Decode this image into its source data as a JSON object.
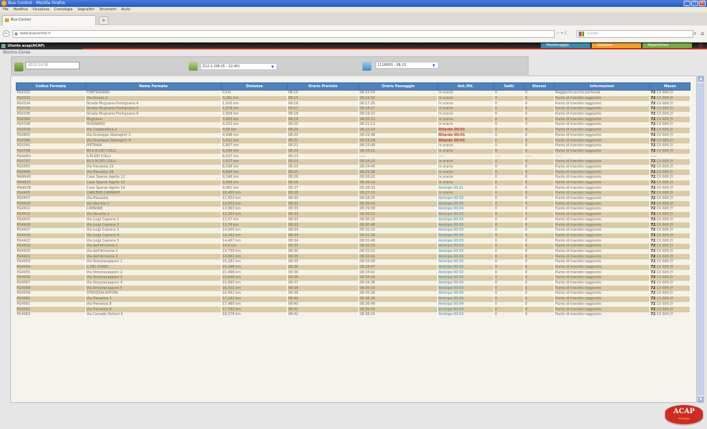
{
  "window": {
    "title": "Bus Control - Mozilla Firefox",
    "minimize": "_",
    "maximize": "□",
    "close": "×"
  },
  "menu": [
    "File",
    "Modifica",
    "Visualizza",
    "Cronologia",
    "Segnalibri",
    "Strumenti",
    "Aiuto"
  ],
  "browser": {
    "tab_title": "Bus Control",
    "new_tab": "+",
    "back": "←",
    "url": "www.buscontrol.it",
    "url_controls": "☆ ▾ C",
    "search_placeholder": "Google",
    "nav_icons": [
      "⌕",
      "⌂"
    ]
  },
  "app": {
    "user": "Utente acap(ACAP)",
    "tabs": [
      "Monitoraggio",
      "Gestione",
      "Reportistica"
    ],
    "power": "⏻",
    "section_title": "Storico Corse",
    "filters": {
      "date": "2012-10-30",
      "route": "Z12-1 (08:15 - 12:40)",
      "trip": "1116650 - 08:15",
      "dropdown_arrow": "▼"
    },
    "columns": [
      "Codice Fermata",
      "Nome Fermata",
      "Distanza",
      "Orario Previsto",
      "Orario Passaggio",
      "Ant./Rit.",
      "Saliti",
      "Discesi",
      "Informazioni",
      "Mezzo"
    ],
    "rows": [
      [
        "PG0332",
        "FONTIGNANO",
        "0 km",
        "08:15",
        "08:15:54",
        "In orario",
        "0",
        "0",
        "Raggiunto punto partenza",
        "72",
        "CX 600 JY"
      ],
      [
        "PG0333",
        "Via Arezzo 2",
        "0,361 km",
        "08:15",
        "08:16:50",
        "In orario",
        "0",
        "0",
        "Punto di transito raggiunto",
        "72",
        "CX 600 JY"
      ],
      [
        "PG0334",
        "Strada Mugnano-Fontignano 4",
        "1,016 km",
        "08:16",
        "08:17:35",
        "In orario",
        "0",
        "0",
        "Punto di transito raggiunto",
        "72",
        "CX 600 JY"
      ],
      [
        "PG0335",
        "Strada Mugnano-Fontignano 5",
        "1,878 km",
        "08:17",
        "08:18:27",
        "In orario",
        "0",
        "0",
        "Punto di transito raggiunto",
        "72",
        "CX 600 JY"
      ],
      [
        "PG0336",
        "Strada Mugnano-Fontignano 6",
        "2,958 km",
        "08:18",
        "08:19:32",
        "In orario",
        "0",
        "0",
        "Punto di transito raggiunto",
        "72",
        "CX 600 JY"
      ],
      [
        "PG0360",
        "Mugnano",
        "3,683 km",
        "08:19",
        "08:20:12",
        "In orario",
        "0",
        "0",
        "Punto di transito raggiunto",
        "72",
        "CX 600 JY"
      ],
      [
        "PG0338",
        "MUGNANO",
        "4,253 km",
        "08:20",
        "08:21:13",
        "In orario",
        "0",
        "0",
        "Punto di transito raggiunto",
        "72",
        "CX 600 JY"
      ],
      [
        "PG0339",
        "Via Cooperativa 2",
        "4,58 km",
        "08:20",
        "08:22:14",
        "Ritardo 00:01",
        "0",
        "0",
        "Punto di transito raggiunto",
        "72",
        "CX 600 JY"
      ],
      [
        "PG0855",
        "Via Giuseppe Sbaraglini 3",
        "4,948 km",
        "08:20",
        "08:22:48",
        "Ritardo 00:01",
        "0",
        "0",
        "Punto di transito raggiunto",
        "72",
        "CX 600 JY"
      ],
      [
        "PG0340",
        "Via Giuseppe Sbaraglini 4",
        "5,452 km",
        "08:21",
        "08:23:18",
        "Ritardo 00:01",
        "0",
        "0",
        "Punto di transito raggiunto",
        "72",
        "CX 600 JY"
      ],
      [
        "PG0341",
        "PIETRAIA",
        "5,807 km",
        "08:22",
        "08:23:49",
        "In orario",
        "0",
        "0",
        "Punto di transito raggiunto",
        "72",
        "CX 600 JY"
      ],
      [
        "PG0708",
        "BV.S.M.DEI COLLI",
        "6,206 km",
        "08:23",
        "08:24:11",
        "In orario",
        "0",
        "0",
        "Punto di transito raggiunto",
        "72",
        "CX 600 JY"
      ],
      [
        "PGAAEU",
        "S.M.DEI COLLI",
        "6,937 km",
        "08:23",
        "-----",
        "-----",
        "-----",
        "-----",
        "-----",
        "",
        "-----"
      ],
      [
        "PG0707",
        "BV.S.M.DEI COLLI",
        "7,627 km",
        "08:23",
        "08:24:15",
        "In orario",
        "0",
        "0",
        "Punto di transito raggiunto",
        "72",
        "CX 600 JY"
      ],
      [
        "PG0455",
        "Via Pievaiola 25",
        "8,036 km",
        "08:23",
        "08:24:45",
        "In orario",
        "0",
        "0",
        "Punto di transito raggiunto",
        "72",
        "CX 600 JY"
      ],
      [
        "PG0456",
        "Via Pievaiola 26",
        "8,884 km",
        "08:25",
        "08:25:38",
        "In orario",
        "0",
        "0",
        "Punto di transito raggiunto",
        "72",
        "CX 600 JY"
      ],
      [
        "MA9640",
        "Case Sparse Agello 12",
        "9,348 km",
        "08:26",
        "08:26:02",
        "In orario",
        "0",
        "0",
        "Punto di transito raggiunto",
        "72",
        "CX 600 JY"
      ],
      [
        "MA9637",
        "Case Sparse Agello 13",
        "9,584 km",
        "08:26",
        "08:26:14",
        "In orario",
        "0",
        "0",
        "Punto di transito raggiunto",
        "72",
        "CX 600 JY"
      ],
      [
        "MA9638",
        "Case Sparse Agello 14",
        "9,961 km",
        "08:27",
        "08:26:33",
        "Anticipo 00:01",
        "0",
        "0",
        "Punto di transito raggiunto",
        "72",
        "CX 600 JY"
      ],
      [
        "PG4405",
        "CARCERE CAPANNE",
        "10,405 km",
        "08:28",
        "08:27:13",
        "In orario",
        "0",
        "0",
        "Punto di transito raggiunto",
        "72",
        "CX 600 JY"
      ],
      [
        "PG0457",
        "Via Pievaiola",
        "11,553 km",
        "08:30",
        "08:28:25",
        "Anticipo 00:02",
        "0",
        "0",
        "Punto di transito raggiunto",
        "72",
        "CX 600 JY"
      ],
      [
        "PG4410",
        "Via Vecchia 1",
        "12,651 km",
        "08:32",
        "08:29:43",
        "Anticipo 00:03",
        "0",
        "0",
        "Punto di transito raggiunto",
        "72",
        "CX 600 JY"
      ],
      [
        "PG4411",
        "CAPANNE",
        "13,063 km",
        "08:33",
        "08:29:58",
        "Anticipo 00:04",
        "0",
        "0",
        "Punto di transito raggiunto",
        "72",
        "CX 600 JY"
      ],
      [
        "PG4412",
        "Via Vecchia 2",
        "13,253 km",
        "08:33",
        "08:30:12",
        "Anticipo 00:03",
        "0",
        "0",
        "Punto di transito raggiunto",
        "72",
        "CX 600 JY"
      ],
      [
        "PG4425",
        "Via Luigi Caprera 1",
        "13,57 km",
        "08:33",
        "08:30:32",
        "Anticipo 00:03",
        "0",
        "0",
        "Punto di transito raggiunto",
        "72",
        "CX 600 JY"
      ],
      [
        "PG4416",
        "Via Luigi Caprera 2",
        "13,79 km",
        "08:33",
        "08:30:48",
        "Anticipo 00:03",
        "0",
        "0",
        "Punto di transito raggiunto",
        "72",
        "CX 600 JY"
      ],
      [
        "PG4417",
        "Via Luigi Caprera 3",
        "14,005 km",
        "08:34",
        "08:31:15",
        "Anticipo 00:03",
        "0",
        "0",
        "Punto di transito raggiunto",
        "72",
        "CX 600 JY"
      ],
      [
        "PG4418",
        "Via Luigi Caprera 4",
        "14,282 km",
        "08:34",
        "08:31:38",
        "Anticipo 00:03",
        "0",
        "0",
        "Punto di transito raggiunto",
        "72",
        "CX 600 JY"
      ],
      [
        "PG4422",
        "Via Luigi Caprera 5",
        "14,407 km",
        "08:34",
        "08:31:46",
        "Anticipo 00:03",
        "0",
        "0",
        "Punto di transito raggiunto",
        "72",
        "CX 600 JY"
      ],
      [
        "PG4419",
        "Via dell'Armonia 1",
        "14,6 km",
        "08:35",
        "08:32:03",
        "Anticipo 00:03",
        "0",
        "0",
        "Punto di transito raggiunto",
        "72",
        "CX 600 JY"
      ],
      [
        "PG4420",
        "Via dell'Armonia 2",
        "14,739 km",
        "08:35",
        "08:32:15",
        "Anticipo 00:03",
        "0",
        "0",
        "Punto di transito raggiunto",
        "72",
        "CX 600 JY"
      ],
      [
        "PG4421",
        "Via dell'Armonia 3",
        "14,961 km",
        "08:35",
        "08:32:41",
        "Anticipo 00:03",
        "0",
        "0",
        "Punto di transito raggiunto",
        "72",
        "CX 600 JY"
      ],
      [
        "PG4053",
        "Via Strozzacapponi 1",
        "15,181 km",
        "08:35",
        "08:33:28",
        "Anticipo 00:02",
        "0",
        "0",
        "Punto di transito raggiunto",
        "72",
        "CX 600 JY"
      ],
      [
        "PG4054",
        "C.DEL PIANO",
        "15,348 km",
        "08:36",
        "08:33:47",
        "Anticipo 00:03",
        "0",
        "0",
        "Punto di transito raggiunto",
        "72",
        "CX 600 JY"
      ],
      [
        "PG4055",
        "Via Strozzacapponi 2",
        "15,498 km",
        "08:36",
        "08:34:02",
        "Anticipo 00:02",
        "0",
        "0",
        "Punto di transito raggiunto",
        "72",
        "CX 600 JY"
      ],
      [
        "PG4056",
        "Via Strozzacapponi 3",
        "15,649 km",
        "08:36",
        "08:34:16",
        "Anticipo 00:02",
        "0",
        "0",
        "Punto di transito raggiunto",
        "72",
        "CX 600 JY"
      ],
      [
        "PG4057",
        "Via Strozzacapponi 4",
        "15,895 km",
        "08:37",
        "08:34:36",
        "Anticipo 00:03",
        "0",
        "0",
        "Punto di transito raggiunto",
        "72",
        "CX 600 JY"
      ],
      [
        "PG4058",
        "Via Strozzacapponi 5",
        "16,331 km",
        "08:38",
        "08:35:10",
        "Anticipo 00:03",
        "0",
        "0",
        "Punto di transito raggiunto",
        "72",
        "CX 600 JY"
      ],
      [
        "PG4059",
        "STROZZACAPPONI",
        "16,491 km",
        "08:39",
        "08:35:36",
        "Anticipo 00:04",
        "0",
        "0",
        "Punto di transito raggiunto",
        "72",
        "CX 600 JY"
      ],
      [
        "PG4060",
        "Via Pievaiola 7",
        "17,182 km",
        "08:40",
        "08:36:28",
        "Anticipo 00:04",
        "0",
        "0",
        "Punto di transito raggiunto",
        "72",
        "CX 600 JY"
      ],
      [
        "PG4061",
        "Via Pievaiola 8",
        "17,485 km",
        "08:40",
        "08:36:49",
        "Anticipo 00:04",
        "0",
        "0",
        "Punto di transito raggiunto",
        "72",
        "CX 600 JY"
      ],
      [
        "PG4062",
        "Via Pievaiola 9",
        "17,792 km",
        "08:41",
        "08:36:42",
        "Anticipo 00:03",
        "0",
        "0",
        "Punto di transito raggiunto",
        "72",
        "CX 600 JY"
      ],
      [
        "PG4063",
        "Via Corrado Dottori 4",
        "18,378 km",
        "08:42",
        "08:36:55",
        "Anticipo 00:03",
        "0",
        "0",
        "Punto di transito raggiunto",
        "72",
        "CX 600 JY"
      ]
    ],
    "scroll_up": "▲",
    "scroll_down": "▼"
  },
  "logo": {
    "text": "ACAP",
    "subtext": "Perugia"
  }
}
